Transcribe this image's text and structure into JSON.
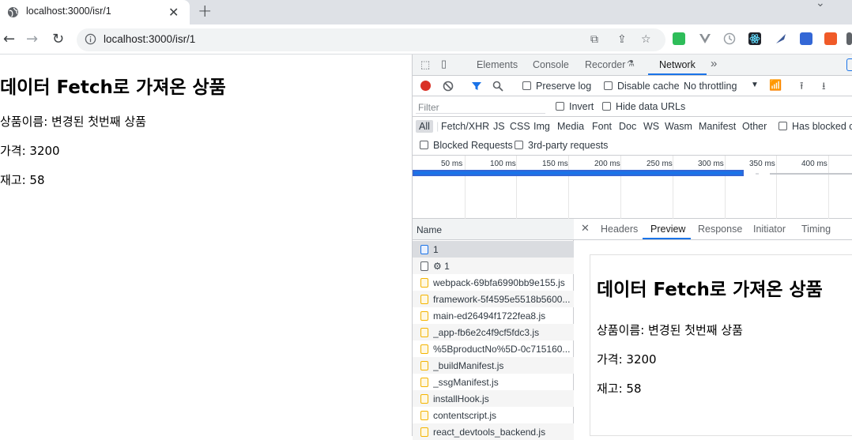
{
  "browser": {
    "tab_title": "localhost:3000/isr/1",
    "url": "localhost:3000/isr/1"
  },
  "page": {
    "heading": "데이터 Fetch로 가져온 상품",
    "lines": [
      "상품이름: 변경된 첫번째 상품",
      "가격: 3200",
      "재고: 58"
    ]
  },
  "devtools": {
    "tabs": [
      "Elements",
      "Console",
      "Recorder",
      "Network"
    ],
    "active_tab": "Network",
    "more": "»",
    "toolbar": {
      "preserve_log": "Preserve log",
      "disable_cache": "Disable cache",
      "throttling": "No throttling"
    },
    "filter": {
      "placeholder": "Filter",
      "invert": "Invert",
      "hide_data_urls": "Hide data URLs"
    },
    "type_filters": [
      "All",
      "Fetch/XHR",
      "JS",
      "CSS",
      "Img",
      "Media",
      "Font",
      "Doc",
      "WS",
      "Wasm",
      "Manifest",
      "Other"
    ],
    "has_blocked": "Has blocked c",
    "blocked_requests": "Blocked Requests",
    "third_party": "3rd-party requests",
    "timeline_ticks": [
      "50 ms",
      "100 ms",
      "150 ms",
      "200 ms",
      "250 ms",
      "300 ms",
      "350 ms",
      "400 ms"
    ],
    "name_header": "Name",
    "requests": [
      {
        "name": "1",
        "type": "doc",
        "selected": true
      },
      {
        "name": "⚙ 1",
        "type": "other"
      },
      {
        "name": "webpack-69bfa6990bb9e155.js",
        "type": "js"
      },
      {
        "name": "framework-5f4595e5518b5600...",
        "type": "js"
      },
      {
        "name": "main-ed26494f1722fea8.js",
        "type": "js"
      },
      {
        "name": "_app-fb6e2c4f9cf5fdc3.js",
        "type": "js"
      },
      {
        "name": "%5BproductNo%5D-0c715160...",
        "type": "js"
      },
      {
        "name": "_buildManifest.js",
        "type": "js"
      },
      {
        "name": "_ssgManifest.js",
        "type": "js"
      },
      {
        "name": "installHook.js",
        "type": "js"
      },
      {
        "name": "contentscript.js",
        "type": "js"
      },
      {
        "name": "react_devtools_backend.js",
        "type": "js"
      }
    ],
    "detail_tabs": [
      "Headers",
      "Preview",
      "Response",
      "Initiator",
      "Timing"
    ],
    "active_detail_tab": "Preview",
    "preview": {
      "heading": "데이터 Fetch로 가져온 상품",
      "lines": [
        "상품이름: 변경된 첫번째 상품",
        "가격: 3200",
        "재고: 58"
      ]
    }
  },
  "colors": {
    "accent": "#1a73e8",
    "record": "#d93025",
    "js_icon": "#f4b400"
  }
}
